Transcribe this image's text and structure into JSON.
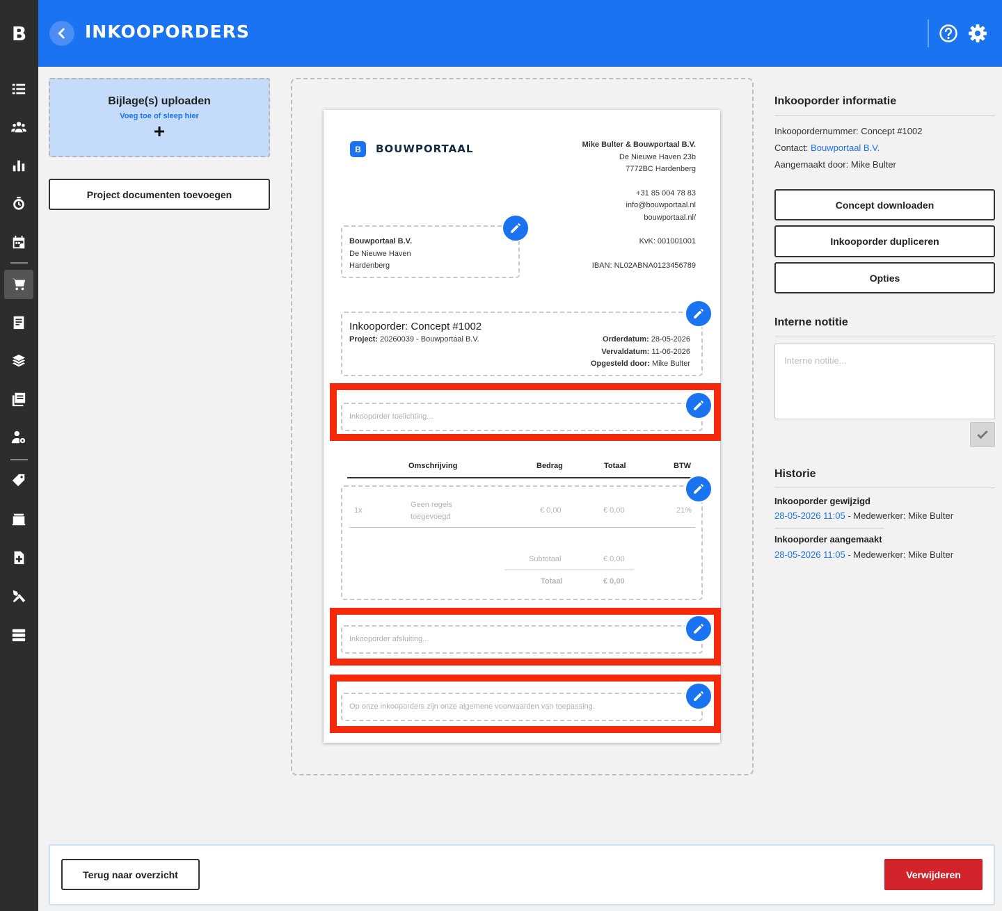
{
  "app": {
    "logo": "B",
    "title": "INKOOPORDERS"
  },
  "sidebar": {
    "items": [
      {
        "icon": "list-icon"
      },
      {
        "icon": "users-icon"
      },
      {
        "icon": "bar-chart-icon"
      },
      {
        "icon": "stopwatch-icon"
      },
      {
        "icon": "calendar-icon"
      },
      {
        "icon": "cart-icon",
        "active": true
      },
      {
        "icon": "receipt-icon"
      },
      {
        "icon": "layers-icon"
      },
      {
        "icon": "documents-icon"
      },
      {
        "icon": "user-cog-icon"
      },
      {
        "icon": "tag-icon"
      },
      {
        "icon": "book-icon"
      },
      {
        "icon": "file-plus-icon"
      },
      {
        "icon": "tools-icon"
      },
      {
        "icon": "server-icon"
      }
    ]
  },
  "left": {
    "upload_title": "Bijlage(s) uploaden",
    "upload_sub": "Voeg toe of sleep hier",
    "upload_plus": "+",
    "project_docs": "Project documenten toevoegen"
  },
  "paper": {
    "brand": "BOUWPORTAAL",
    "brand_icon": "B",
    "sender": {
      "name": "Mike Bulter & Bouwportaal B.V.",
      "street": "De Nieuwe Haven 23b",
      "city": "7772BC Hardenberg",
      "phone": "+31 85 004 78 83",
      "email": "info@bouwportaal.nl",
      "web": "bouwportaal.nl/",
      "kvk": "KvK: 001001001",
      "iban": "IBAN: NL02ABNA0123456789"
    },
    "recipient": {
      "name": "Bouwportaal B.V.",
      "street": "De Nieuwe Haven",
      "city": "Hardenberg"
    },
    "order": {
      "title": "Inkooporder: Concept #1002",
      "project_label": "Project:",
      "project_value": "20260039 - Bouwportaal B.V.",
      "orderdatum_label": "Orderdatum:",
      "orderdatum_value": "28-05-2026",
      "vervaldatum_label": "Vervaldatum:",
      "vervaldatum_value": "11-06-2026",
      "opgesteld_label": "Opgesteld door:",
      "opgesteld_value": "Mike Bulter"
    },
    "toelichting_placeholder": "Inkooporder toelichting...",
    "table": {
      "headers": [
        "Omschrijving",
        "Bedrag",
        "Totaal",
        "BTW"
      ],
      "row": {
        "qty": "1x",
        "desc_line1": "Geen regels",
        "desc_line2": "toegevoegd",
        "bedrag": "€ 0,00",
        "totaal": "€ 0,00",
        "btw": "21%"
      },
      "subtotaal_label": "Subtotaal",
      "subtotaal_value": "€ 0,00",
      "totaal_label": "Totaal",
      "totaal_value": "€ 0,00"
    },
    "afsluiting_placeholder": "Inkooporder afsluiting...",
    "voorwaarden_placeholder": "Op onze inkooporders zijn onze algemene voorwaarden van toepassing."
  },
  "info": {
    "title": "Inkooporder informatie",
    "nummer_label": "Inkoopordernummer:",
    "nummer_value": "Concept #1002",
    "contact_label": "Contact:",
    "contact_value": "Bouwportaal B.V.",
    "aangemaakt_label": "Aangemaakt door:",
    "aangemaakt_value": "Mike Bulter",
    "btn_download": "Concept downloaden",
    "btn_dupliceren": "Inkooporder dupliceren",
    "btn_opties": "Opties"
  },
  "notitie": {
    "title": "Interne notitie",
    "placeholder": "Interne notitie..."
  },
  "historie": {
    "title": "Historie",
    "entries": [
      {
        "title": "Inkooporder gewijzigd",
        "date": "28-05-2026 11:05",
        "by": "- Medewerker: Mike Bulter"
      },
      {
        "title": "Inkooporder aangemaakt",
        "date": "28-05-2026 11:05",
        "by": "- Medewerker: Mike Bulter"
      }
    ]
  },
  "footer": {
    "back": "Terug naar overzicht",
    "delete": "Verwijderen"
  },
  "colors": {
    "primary": "#1a73f0",
    "sidebar": "#2d2d2d",
    "danger": "#d3232a",
    "highlight": "#f52a0c"
  }
}
